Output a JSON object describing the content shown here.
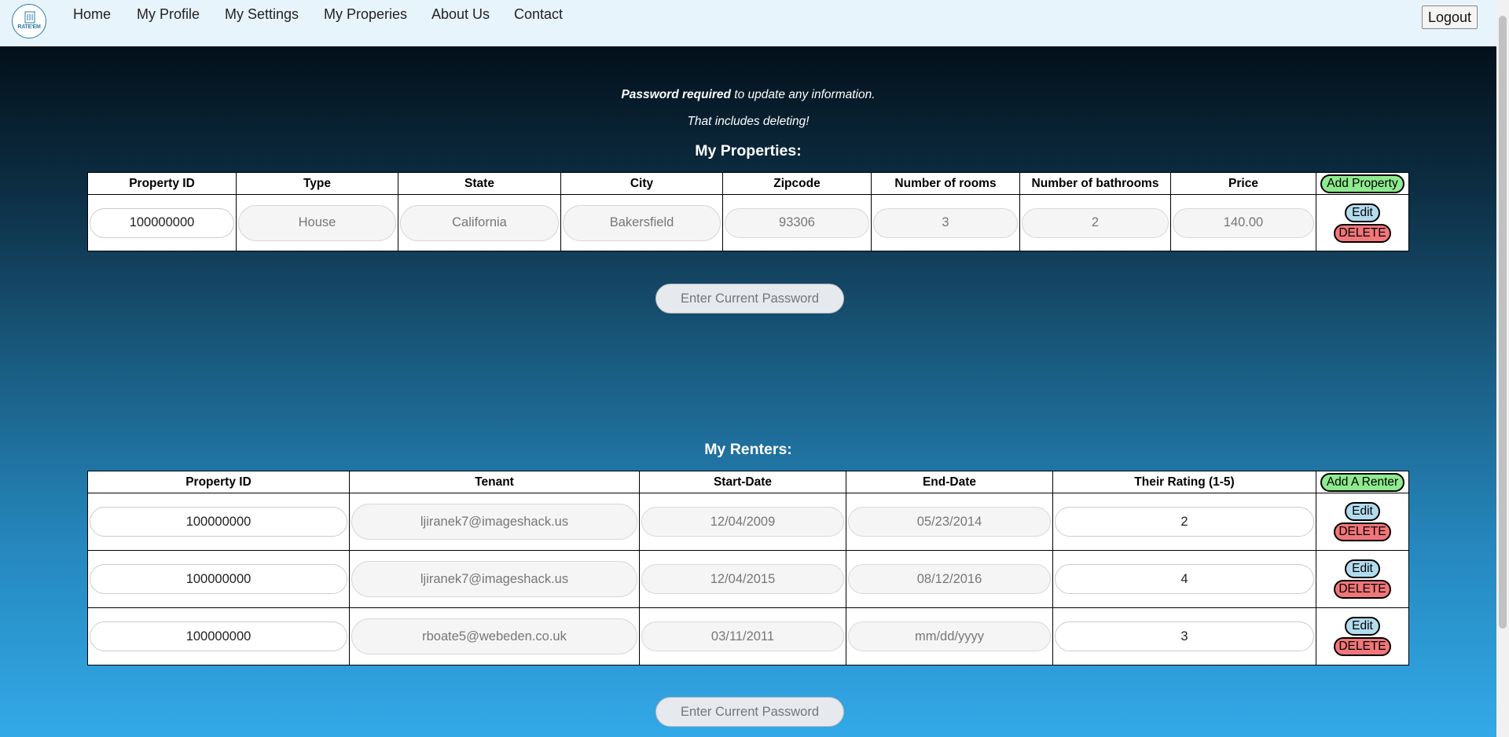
{
  "nav": {
    "logo_text": "RATE'EM",
    "links": [
      "Home",
      "My Profile",
      "My Settings",
      "My Properies",
      "About Us",
      "Contact"
    ],
    "logout_label": "Logout"
  },
  "notice": {
    "bold_text": "Password required",
    "rest_text": " to update any information.",
    "line2": "That includes deleting!"
  },
  "properties": {
    "title": "My Properties:",
    "headers": [
      "Property ID",
      "Type",
      "State",
      "City",
      "Zipcode",
      "Number of rooms",
      "Number of bathrooms",
      "Price"
    ],
    "add_label": "Add Property",
    "rows": [
      {
        "id": "100000000",
        "type": "House",
        "state": "California",
        "city": "Bakersfield",
        "zip": "93306",
        "rooms": "3",
        "baths": "2",
        "price": "140.00"
      }
    ],
    "edit_label": "Edit",
    "delete_label": "DELETE",
    "password_placeholder": "Enter Current Password"
  },
  "renters": {
    "title": "My Renters:",
    "headers": [
      "Property ID",
      "Tenant",
      "Start-Date",
      "End-Date",
      "Their Rating (1-5)"
    ],
    "add_label": "Add A Renter",
    "rows": [
      {
        "id": "100000000",
        "tenant": "ljiranek7@imageshack.us",
        "start": "12/04/2009",
        "end": "05/23/2014",
        "rating": "2"
      },
      {
        "id": "100000000",
        "tenant": "ljiranek7@imageshack.us",
        "start": "12/04/2015",
        "end": "08/12/2016",
        "rating": "4"
      },
      {
        "id": "100000000",
        "tenant": "rboate5@webeden.co.uk",
        "start": "03/11/2011",
        "end": "mm/dd/yyyy",
        "rating": "3"
      }
    ],
    "edit_label": "Edit",
    "delete_label": "DELETE",
    "password_placeholder": "Enter Current Password"
  },
  "colors": {
    "nav_bg": "#e8f4fc",
    "add_button": "#8eea8e",
    "edit_button": "#b2dcee",
    "delete_button": "#f0767a"
  },
  "icons": {
    "logo": "building-logo-icon"
  }
}
